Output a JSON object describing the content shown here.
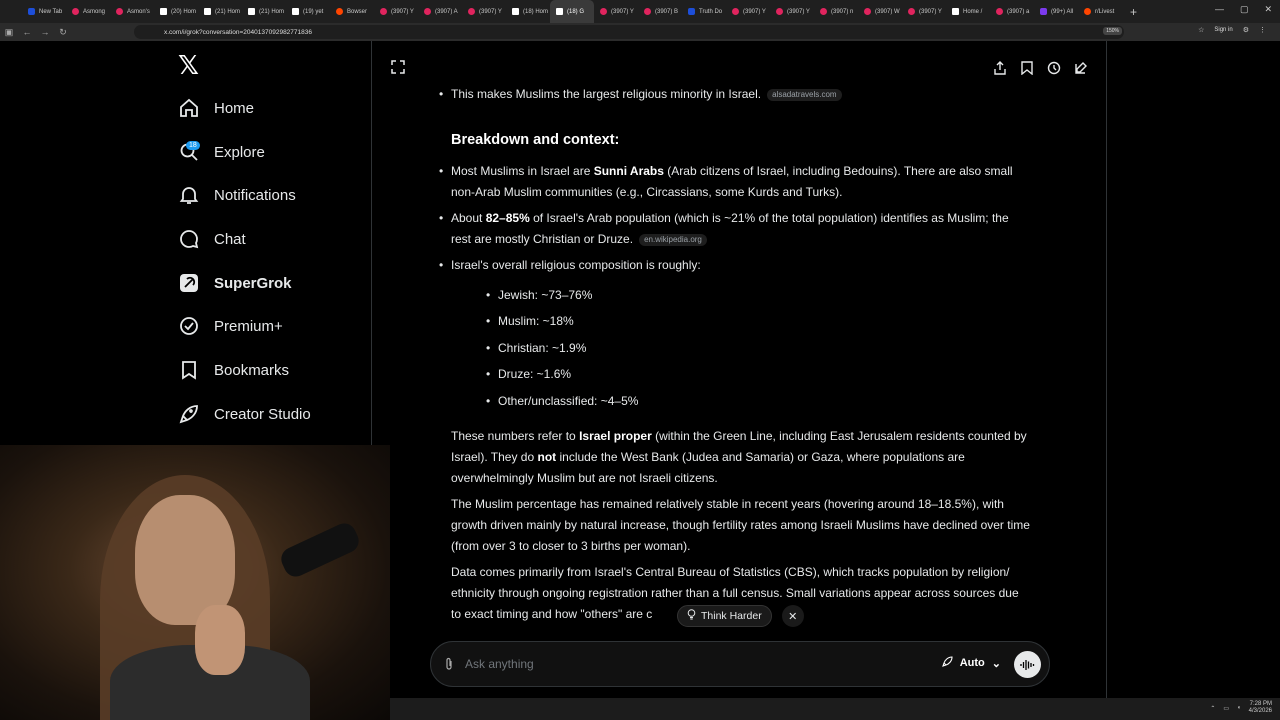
{
  "browser": {
    "tabs": [
      {
        "label": "New Tab",
        "kind": "blue"
      },
      {
        "label": "Asmong",
        "kind": "red"
      },
      {
        "label": "Asmon's",
        "kind": "red"
      },
      {
        "label": "(20) Hom",
        "kind": "x"
      },
      {
        "label": "(21) Hom",
        "kind": "x"
      },
      {
        "label": "(21) Hom",
        "kind": "x"
      },
      {
        "label": "(19) yet",
        "kind": "x"
      },
      {
        "label": "Bowser",
        "kind": "orange"
      },
      {
        "label": "(3907) Y",
        "kind": "red"
      },
      {
        "label": "(3907) A",
        "kind": "red"
      },
      {
        "label": "(3907) Y",
        "kind": "red"
      },
      {
        "label": "(18) Hom",
        "kind": "x"
      },
      {
        "label": "(18) G",
        "kind": "x",
        "active": true
      },
      {
        "label": "(3907) Y",
        "kind": "red"
      },
      {
        "label": "(3907) B",
        "kind": "red"
      },
      {
        "label": "Truth Do",
        "kind": "blue"
      },
      {
        "label": "(3907) Y",
        "kind": "red"
      },
      {
        "label": "(3907) Y",
        "kind": "red"
      },
      {
        "label": "(3907) n",
        "kind": "red"
      },
      {
        "label": "(3907) W",
        "kind": "red"
      },
      {
        "label": "(3907) Y",
        "kind": "red"
      },
      {
        "label": "Home /",
        "kind": "x"
      },
      {
        "label": "(3907) a",
        "kind": "red"
      },
      {
        "label": "(99+) All",
        "kind": "purple"
      },
      {
        "label": "r/Livest",
        "kind": "orange"
      }
    ],
    "url": "x.com/i/grok?conversation=2040137092982771836",
    "zoom": "150%",
    "signin_label": "Sign in"
  },
  "sidebar": {
    "notifications_badge": "18",
    "items": [
      {
        "label": "Home",
        "icon": "home-icon"
      },
      {
        "label": "Explore",
        "icon": "search-icon"
      },
      {
        "label": "Notifications",
        "icon": "bell-icon"
      },
      {
        "label": "Chat",
        "icon": "chat-icon"
      },
      {
        "label": "SuperGrok",
        "icon": "grok-icon"
      },
      {
        "label": "Premium+",
        "icon": "verified-icon"
      },
      {
        "label": "Bookmarks",
        "icon": "bookmark-icon"
      },
      {
        "label": "Creator Studio",
        "icon": "rocket-icon"
      }
    ]
  },
  "conversation": {
    "b0_text": "This makes Muslims the largest religious minority in Israel.",
    "b0_src": "alsadatravels.com",
    "heading": "Breakdown and context:",
    "b1_pre": "Most Muslims in Israel are ",
    "b1_bold": "Sunni Arabs",
    "b1_post": " (Arab citizens of Israel, including Bedouins). There are also small non-Arab Muslim communities (e.g., Circassians, some Kurds and Turks).",
    "b2_pre": "About ",
    "b2_bold": "82–85%",
    "b2_post": " of Israel's Arab population (which is ~21% of the total population) identifies as Muslim; the rest are mostly Christian or Druze.",
    "b2_src": "en.wikipedia.org",
    "b3_text": "Israel's overall religious composition is roughly:",
    "composition": [
      "Jewish: ~73–76%",
      "Muslim: ~18%",
      "Christian: ~1.9%",
      "Druze: ~1.6%",
      "Other/unclassified: ~4–5%"
    ],
    "p1_pre": "These numbers refer to ",
    "p1_bold": "Israel proper",
    "p1_mid": " (within the Green Line, including East Jerusalem residents counted by Israel). They do ",
    "p1_bold2": "not",
    "p1_post": " include the West Bank (Judea and Samaria) or Gaza, where populations are overwhelmingly Muslim but are not Israeli citizens.",
    "p2": "The Muslim percentage has remained relatively stable in recent years (hovering around 18–18.5%), with growth driven mainly by natural increase, though fertility rates among Israeli Muslims have declined over time (from over 3 to closer to 3 births per woman).",
    "p3": "Data comes primarily from Israel's Central Bureau of Statistics (CBS), which tracks population by religion/ ethnicity through ongoing registration rather than a full census. Small variations appear across sources due to exact timing and how \"others\" are c",
    "think_harder": "Think Harder"
  },
  "composer": {
    "placeholder": "Ask anything",
    "mode": "Auto"
  },
  "taskbar": {
    "time": "7:28 PM",
    "date": "4/3/2026"
  }
}
